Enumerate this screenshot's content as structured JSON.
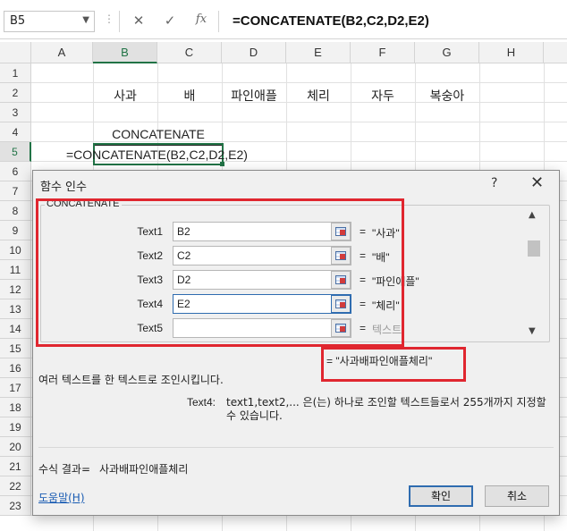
{
  "formula_bar": {
    "name_box": "B5",
    "fx_label": "fx",
    "formula": "=CONCATENATE(B2,C2,D2,E2)"
  },
  "columns": [
    "A",
    "B",
    "C",
    "D",
    "E",
    "F",
    "G",
    "H"
  ],
  "rows": [
    "1",
    "2",
    "3",
    "4",
    "5",
    "6",
    "7",
    "8",
    "9",
    "10",
    "11",
    "12",
    "13",
    "14",
    "15",
    "16",
    "17",
    "18",
    "19",
    "20",
    "21",
    "22",
    "23"
  ],
  "sheet": {
    "row2": [
      "사과",
      "배",
      "파인애플",
      "체리",
      "자두",
      "복숭아"
    ],
    "row4": "CONCATENATE",
    "row5": "=CONCATENATE(B2,C2,D2,E2)"
  },
  "dialog": {
    "title": "함수 인수",
    "help_glyph": "?",
    "close_glyph": "✕",
    "function_name": "CONCATENATE",
    "args": [
      {
        "label": "Text1",
        "value": "B2",
        "result": "\"사과\""
      },
      {
        "label": "Text2",
        "value": "C2",
        "result": "\"배\""
      },
      {
        "label": "Text3",
        "value": "D2",
        "result": "\"파인애플\""
      },
      {
        "label": "Text4",
        "value": "E2",
        "result": "\"체리\""
      },
      {
        "label": "Text5",
        "value": "",
        "result": "텍스트"
      }
    ],
    "equals": "=",
    "overall_result": "= \"사과배파인애플체리\"",
    "description": "여러 텍스트를 한 텍스트로 조인시킵니다.",
    "arg_desc_name": "Text4:",
    "arg_desc": "text1,text2,... 은(는) 하나로 조인할 텍스트들로서 255개까지 지정할 수 있습니다.",
    "result_label": "수식 결과=",
    "result_value": "사과배파인애플체리",
    "help_link": "도움말(H)",
    "ok_label": "확인",
    "cancel_label": "취소"
  },
  "colors": {
    "excel_green": "#217346",
    "highlight_red": "#e0262f",
    "link_blue": "#1a5cb3"
  }
}
